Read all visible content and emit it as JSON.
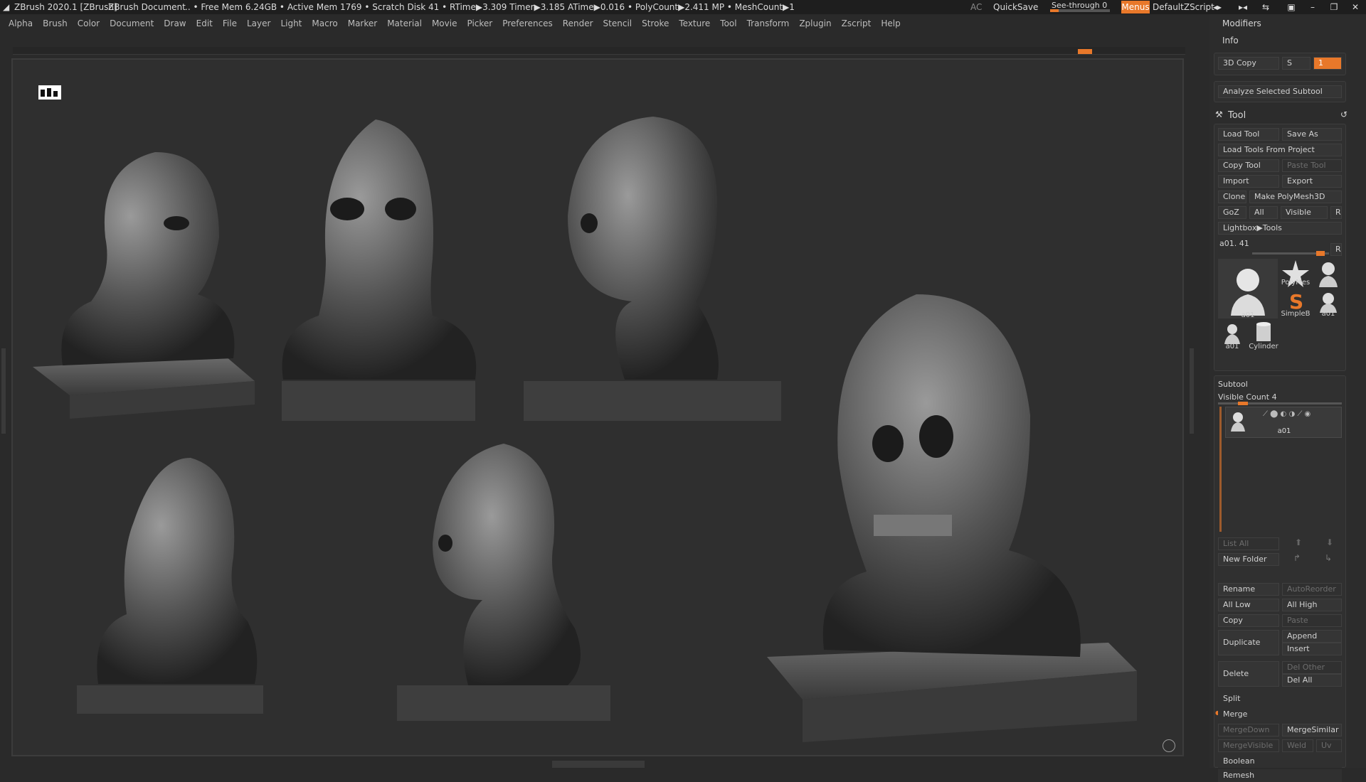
{
  "titlebar": {
    "app_title": "ZBrush 2020.1 [ZBrush]",
    "document": "ZBrush Document",
    "stats": ".. • Free Mem 6.24GB • Active Mem 1769 • Scratch Disk 41 •  RTime▶3.309 Timer▶3.185 ATime▶0.016 • PolyCount▶2.411 MP • MeshCount▶1",
    "ac": "AC",
    "quicksave": "QuickSave",
    "seethrough": "See-through  0",
    "menus": "Menus",
    "default_zscript": "DefaultZScript"
  },
  "menubar": {
    "items": [
      "Alpha",
      "Brush",
      "Color",
      "Document",
      "Draw",
      "Edit",
      "File",
      "Layer",
      "Light",
      "Macro",
      "Marker",
      "Material",
      "Movie",
      "Picker",
      "Preferences",
      "Render",
      "Stencil",
      "Stroke",
      "Texture",
      "Tool",
      "Transform",
      "Zplugin",
      "Zscript",
      "Help"
    ]
  },
  "right_panel": {
    "modifiers": "Modifiers",
    "info": "Info",
    "copy3d": "3D Copy",
    "copy3d_s": "S",
    "copy3d_value": "1",
    "analyze": "Analyze Selected Subtool",
    "tool_header": "Tool",
    "load_tool": "Load Tool",
    "save_as": "Save As",
    "load_from_project": "Load Tools From Project",
    "copy_tool": "Copy Tool",
    "paste_tool": "Paste Tool",
    "import": "Import",
    "export": "Export",
    "clone": "Clone",
    "make_polymesh": "Make PolyMesh3D",
    "goz": "GoZ",
    "all": "All",
    "visible": "Visible",
    "r": "R",
    "lightbox_tools": "Lightbox▶Tools",
    "current_tool": "a01. 41",
    "slider_r": "R",
    "thumbs": [
      {
        "label": "a01"
      },
      {
        "label": "PolyMes"
      },
      {
        "label": "a01"
      },
      {
        "label": "SimpleB"
      },
      {
        "label": "a01"
      },
      {
        "label": "a01"
      },
      {
        "label": "Cylinder"
      }
    ],
    "subtool": {
      "title": "Subtool",
      "visible_count": "Visible Count 4",
      "item_label": "a01",
      "list_all": "List All",
      "new_folder": "New Folder",
      "rename": "Rename",
      "auto_reorder": "AutoReorder",
      "all_low": "All Low",
      "all_high": "All High",
      "copy": "Copy",
      "paste": "Paste",
      "duplicate": "Duplicate",
      "append": "Append",
      "insert": "Insert",
      "delete": "Delete",
      "del_other": "Del Other",
      "del_all": "Del All",
      "split": "Split",
      "merge": "Merge",
      "merge_down": "MergeDown",
      "merge_similar": "MergeSimilar",
      "merge_visible": "MergeVisible",
      "weld": "Weld",
      "uv": "Uv",
      "boolean": "Boolean",
      "remesh": "Remesh"
    }
  },
  "colors": {
    "accent": "#e8782a",
    "bg": "#2a2a2a",
    "canvas": "#2f2f2f"
  }
}
